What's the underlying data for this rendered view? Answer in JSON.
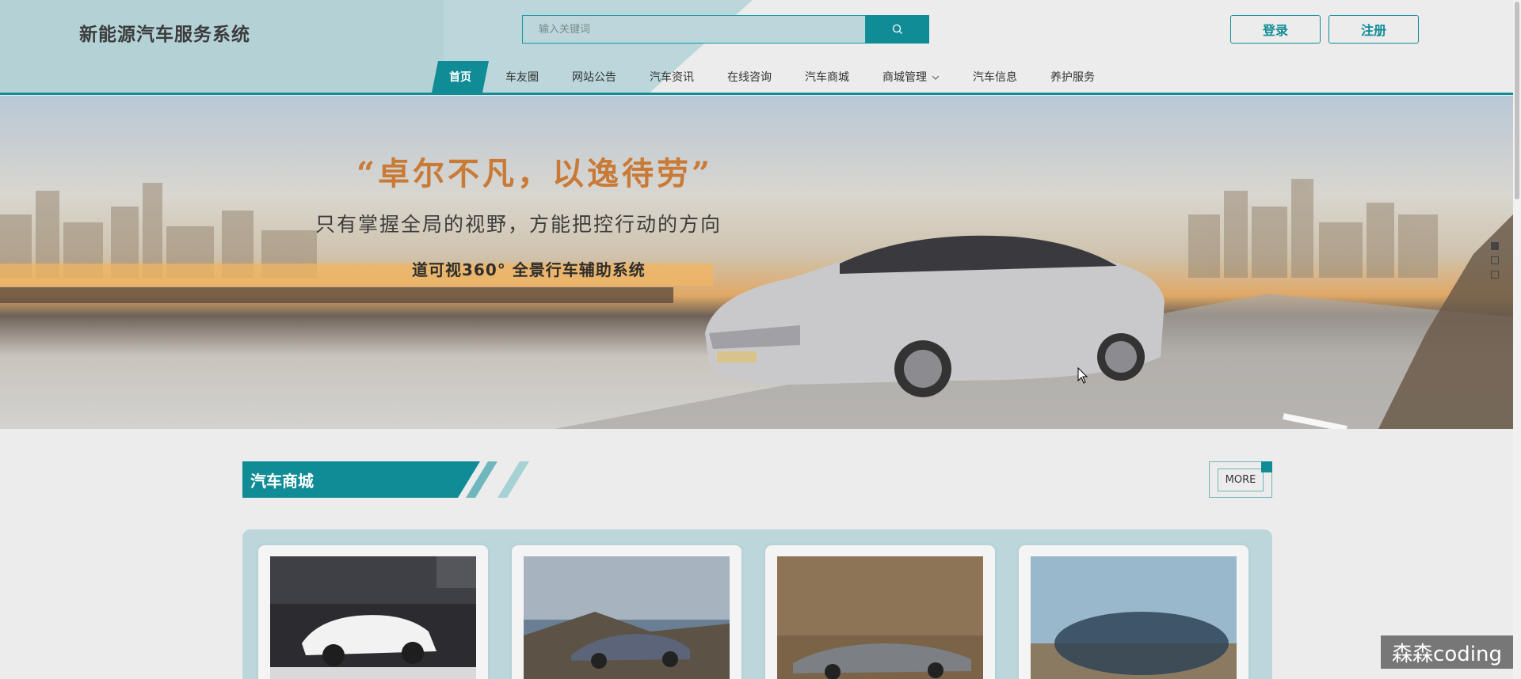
{
  "header": {
    "site_title": "新能源汽车服务系统",
    "search_placeholder": "输入关键词",
    "login_label": "登录",
    "register_label": "注册"
  },
  "nav": {
    "items": [
      {
        "label": "首页",
        "active": true
      },
      {
        "label": "车友圈"
      },
      {
        "label": "网站公告"
      },
      {
        "label": "汽车资讯"
      },
      {
        "label": "在线咨询"
      },
      {
        "label": "汽车商城"
      },
      {
        "label": "商城管理",
        "has_dropdown": true
      },
      {
        "label": "汽车信息"
      },
      {
        "label": "养护服务"
      }
    ]
  },
  "banner": {
    "quote": "“卓尔不凡，以逸待劳”",
    "subtitle": "只有掌握全局的视野，方能把控行动的方向",
    "tagline": "道可视360° 全景行车辅助系统",
    "slide_count": 3,
    "active_slide": 0
  },
  "section": {
    "title": "汽车商城",
    "more_label": "MORE"
  },
  "watermark": "森森coding",
  "colors": {
    "accent": "#108c96",
    "header_tint": "#bcd7db",
    "background": "#ececec"
  }
}
